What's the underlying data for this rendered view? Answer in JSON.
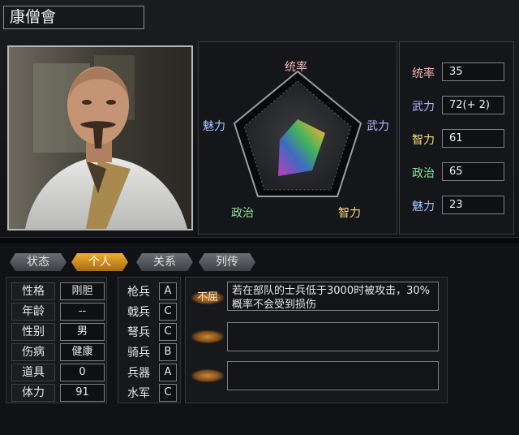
{
  "general": {
    "name": "康僧會"
  },
  "radar": {
    "labels": {
      "top": "统率",
      "right": "武力",
      "bottom_right": "智力",
      "bottom_left": "政治",
      "left": "魅力"
    },
    "label_colors": {
      "top": "#f2b6b6",
      "right": "#b4b8ff",
      "bottom_right": "#f5e07a",
      "bottom_left": "#8fe39a",
      "left": "#9ec8ff"
    }
  },
  "stats": [
    {
      "label": "统率",
      "value": "35",
      "color": "#f2b6b6"
    },
    {
      "label": "武力",
      "value": "72(+ 2)",
      "color": "#b4b8ff"
    },
    {
      "label": "智力",
      "value": "61",
      "color": "#f5e07a"
    },
    {
      "label": "政治",
      "value": "65",
      "color": "#8fe39a"
    },
    {
      "label": "魅力",
      "value": "23",
      "color": "#9ec8ff"
    }
  ],
  "tabs": [
    {
      "label": "状态",
      "active": false
    },
    {
      "label": "个人",
      "active": true
    },
    {
      "label": "关系",
      "active": false
    },
    {
      "label": "列传",
      "active": false
    }
  ],
  "attributes": [
    {
      "key": "性格",
      "value": "刚胆"
    },
    {
      "key": "年龄",
      "value": "--"
    },
    {
      "key": "性别",
      "value": "男"
    },
    {
      "key": "伤病",
      "value": "健康"
    },
    {
      "key": "道具",
      "value": "0"
    },
    {
      "key": "体力",
      "value": "91"
    }
  ],
  "troops": [
    {
      "type": "枪兵",
      "grade": "A"
    },
    {
      "type": "戟兵",
      "grade": "C"
    },
    {
      "type": "弩兵",
      "grade": "C"
    },
    {
      "type": "骑兵",
      "grade": "B"
    },
    {
      "type": "兵器",
      "grade": "A"
    },
    {
      "type": "水军",
      "grade": "C"
    }
  ],
  "skills": [
    {
      "name": "不屈",
      "description": "若在部队的士兵低于3000时被攻击，30%概率不会受到损伤"
    },
    {
      "name": "",
      "description": ""
    },
    {
      "name": "",
      "description": ""
    }
  ]
}
